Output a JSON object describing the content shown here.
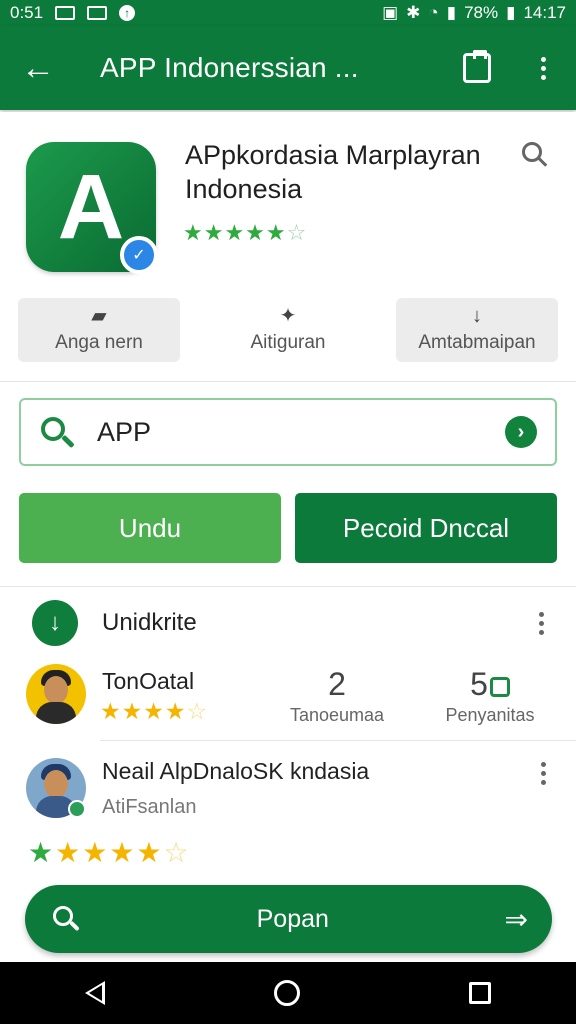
{
  "status_bar": {
    "time_left": "0:51",
    "battery": "78%",
    "time_right": "14:17"
  },
  "app_bar": {
    "title": "APP Indonerssian ...",
    "back_icon": "arrow-left-icon",
    "clipboard_icon": "clipboard-icon",
    "menu_icon": "more-vert-icon"
  },
  "app": {
    "name_line1": "APpkordasia Marplayran",
    "name_line2": "Indonesia",
    "rating": 4.5,
    "icon_letter": "A",
    "accent": "#0b7a3a"
  },
  "actions": [
    {
      "label": "Anga nern",
      "icon": "phone-icon",
      "filled": true
    },
    {
      "label": "Aitiguran",
      "icon": "sparkle-icon",
      "filled": false
    },
    {
      "label": "Amtabmaipan",
      "icon": "download-arrow-icon",
      "filled": true
    }
  ],
  "search": {
    "value": "APP"
  },
  "buttons": {
    "primary_label": "Undu",
    "secondary_label": "Pecoid Dnccal"
  },
  "download_row": {
    "label": "Unidkrite"
  },
  "user1": {
    "name": "TonOatal",
    "rating": 4,
    "stat1_value": "2",
    "stat1_label": "Tanoeumaa",
    "stat2_value": "5",
    "stat2_label": "Penyanitas"
  },
  "user2": {
    "name": "Neail AlpDnaloSK kndasia",
    "subtitle": "AtiFsanlan",
    "rating": 4.5
  },
  "fab": {
    "label": "Popan"
  },
  "colors": {
    "primary": "#0b7a3a",
    "light_green": "#4cb050",
    "star_gold": "#f4b400"
  }
}
